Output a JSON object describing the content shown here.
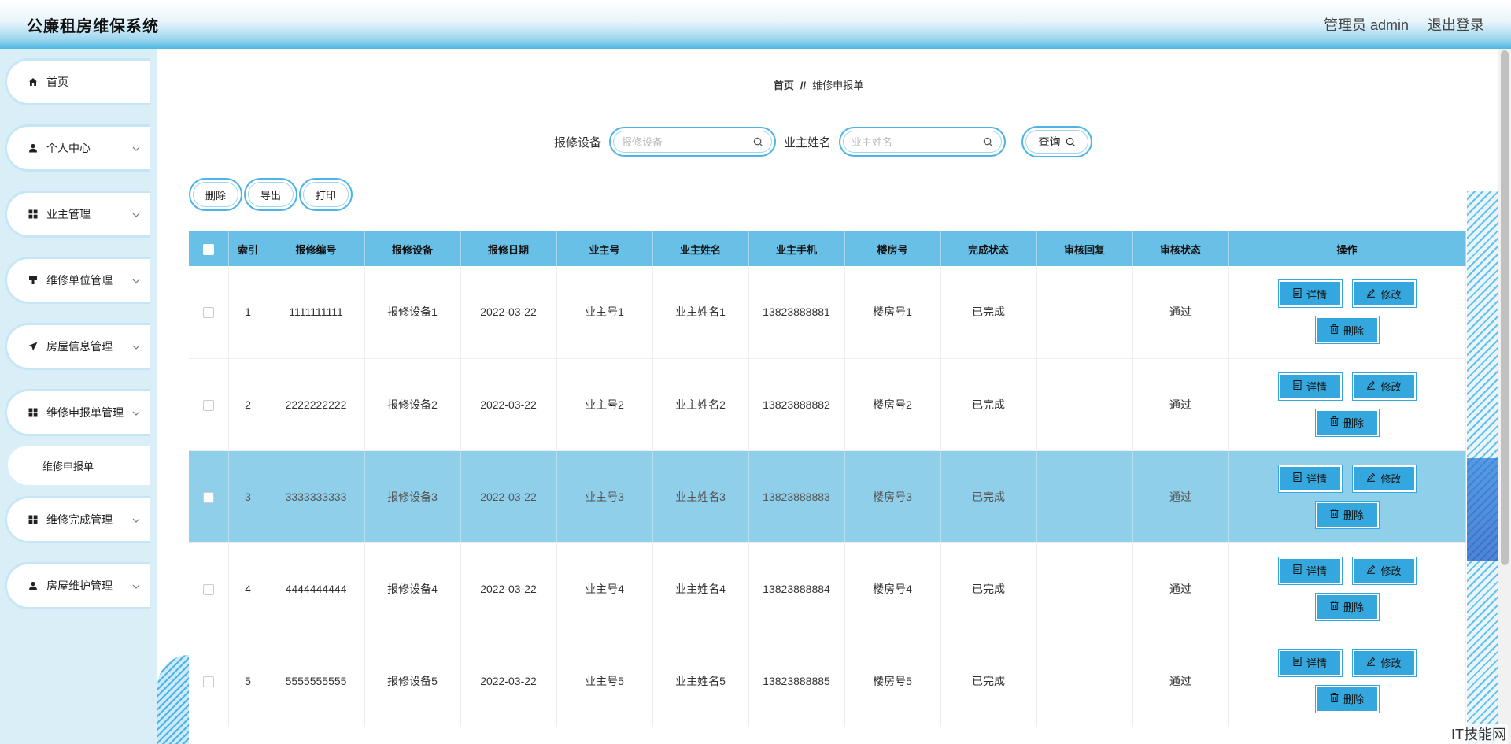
{
  "header": {
    "title": "公廉租房维保系统",
    "user": "管理员 admin",
    "logout": "退出登录"
  },
  "sidebar": {
    "items": [
      {
        "label": "首页",
        "icon": "home-icon"
      },
      {
        "label": "个人中心",
        "icon": "user-icon"
      },
      {
        "label": "业主管理",
        "icon": "grid-icon"
      },
      {
        "label": "维修单位管理",
        "icon": "stamp-icon"
      },
      {
        "label": "房屋信息管理",
        "icon": "send-icon"
      },
      {
        "label": "维修申报单管理",
        "icon": "grid-icon"
      },
      {
        "label": "维修完成管理",
        "icon": "grid-icon"
      },
      {
        "label": "房屋维护管理",
        "icon": "user-icon"
      }
    ],
    "sub_item": "维修申报单"
  },
  "breadcrumb": {
    "home": "首页",
    "sep": "//",
    "current": "维修申报单"
  },
  "search": {
    "device_label": "报修设备",
    "device_placeholder": "报修设备",
    "name_label": "业主姓名",
    "name_placeholder": "业主姓名",
    "query": "查询"
  },
  "actions": {
    "delete": "删除",
    "export": "导出",
    "print": "打印"
  },
  "table": {
    "headers": [
      "索引",
      "报修编号",
      "报修设备",
      "报修日期",
      "业主号",
      "业主姓名",
      "业主手机",
      "楼房号",
      "完成状态",
      "审核回复",
      "审核状态",
      "操作"
    ],
    "rows": [
      {
        "idx": "1",
        "no": "1111111111",
        "device": "报修设备1",
        "date": "2022-03-22",
        "owner": "业主号1",
        "name": "业主姓名1",
        "phone": "13823888881",
        "bld": "楼房号1",
        "done": "已完成",
        "reply": "",
        "audit": "通过"
      },
      {
        "idx": "2",
        "no": "2222222222",
        "device": "报修设备2",
        "date": "2022-03-22",
        "owner": "业主号2",
        "name": "业主姓名2",
        "phone": "13823888882",
        "bld": "楼房号2",
        "done": "已完成",
        "reply": "",
        "audit": "通过"
      },
      {
        "idx": "3",
        "no": "3333333333",
        "device": "报修设备3",
        "date": "2022-03-22",
        "owner": "业主号3",
        "name": "业主姓名3",
        "phone": "13823888883",
        "bld": "楼房号3",
        "done": "已完成",
        "reply": "",
        "audit": "通过"
      },
      {
        "idx": "4",
        "no": "4444444444",
        "device": "报修设备4",
        "date": "2022-03-22",
        "owner": "业主号4",
        "name": "业主姓名4",
        "phone": "13823888884",
        "bld": "楼房号4",
        "done": "已完成",
        "reply": "",
        "audit": "通过"
      },
      {
        "idx": "5",
        "no": "5555555555",
        "device": "报修设备5",
        "date": "2022-03-22",
        "owner": "业主号5",
        "name": "业主姓名5",
        "phone": "13823888885",
        "bld": "楼房号5",
        "done": "已完成",
        "reply": "",
        "audit": "通过"
      }
    ],
    "op_detail": "详情",
    "op_edit": "修改",
    "op_delete": "删除"
  },
  "watermark": "IT技能网",
  "colors": {
    "accent": "#34a8de",
    "header_row": "#69c0e6",
    "selected_row": "#8fcfea",
    "sidebar_bg": "#daeef8"
  }
}
